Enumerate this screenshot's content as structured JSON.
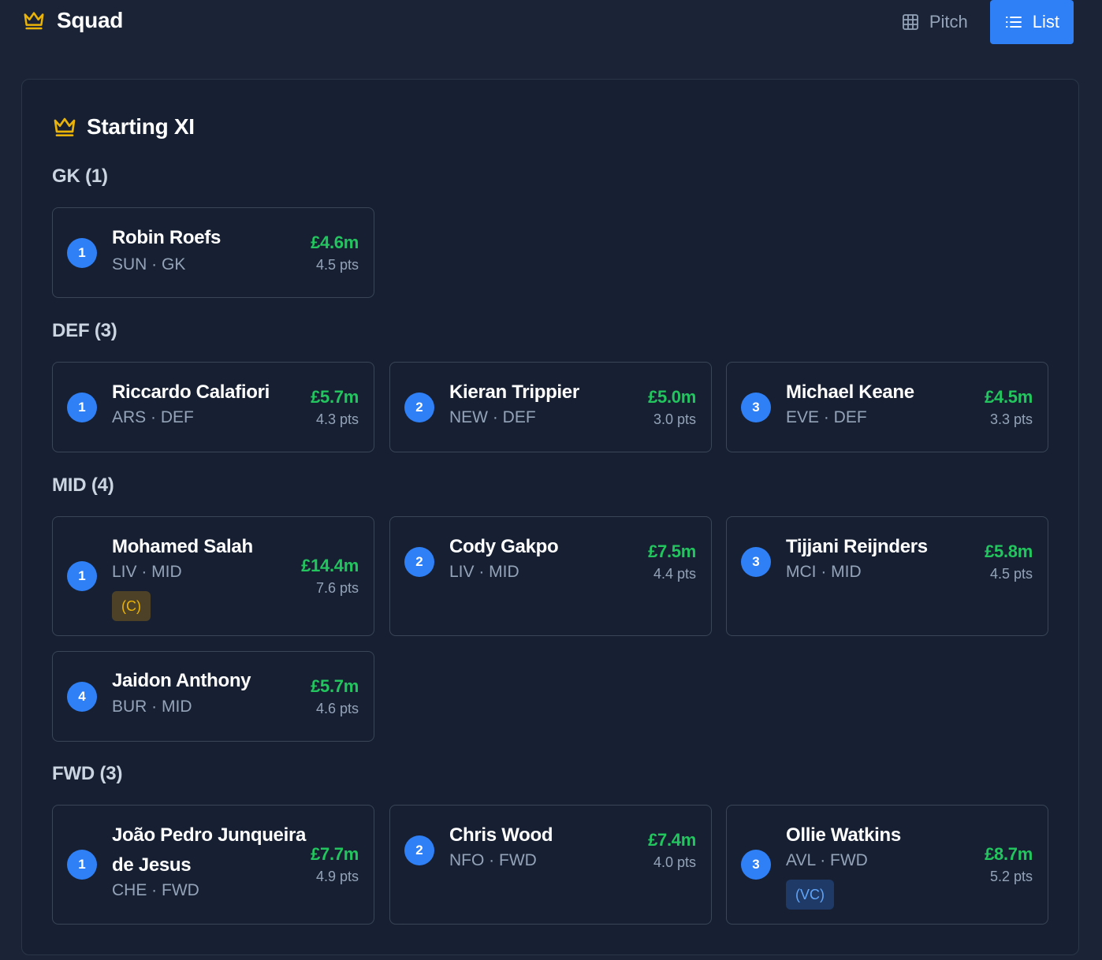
{
  "header": {
    "title": "Squad",
    "views": [
      {
        "label": "Pitch",
        "active": false
      },
      {
        "label": "List",
        "active": true
      }
    ]
  },
  "panel": {
    "title": "Starting XI"
  },
  "groups": [
    {
      "label": "GK (1)",
      "players": [
        {
          "num": "1",
          "name": "Robin Roefs",
          "team": "SUN",
          "pos": "GK",
          "meta": "SUN · GK",
          "price": "£4.6m",
          "pts": "4.5 pts"
        }
      ]
    },
    {
      "label": "DEF (3)",
      "players": [
        {
          "num": "1",
          "name": "Riccardo Calafiori",
          "meta": "ARS · DEF",
          "price": "£5.7m",
          "pts": "4.3 pts"
        },
        {
          "num": "2",
          "name": "Kieran Trippier",
          "meta": "NEW · DEF",
          "price": "£5.0m",
          "pts": "3.0 pts"
        },
        {
          "num": "3",
          "name": "Michael Keane",
          "meta": "EVE · DEF",
          "price": "£4.5m",
          "pts": "3.3 pts"
        }
      ]
    },
    {
      "label": "MID (4)",
      "players": [
        {
          "num": "1",
          "name": "Mohamed Salah",
          "meta": "LIV · MID",
          "price": "£14.4m",
          "pts": "7.6 pts",
          "badge": "(C)"
        },
        {
          "num": "2",
          "name": "Cody Gakpo",
          "meta": "LIV · MID",
          "price": "£7.5m",
          "pts": "4.4 pts"
        },
        {
          "num": "3",
          "name": "Tijjani Reijnders",
          "meta": "MCI · MID",
          "price": "£5.8m",
          "pts": "4.5 pts"
        },
        {
          "num": "4",
          "name": "Jaidon Anthony",
          "meta": "BUR · MID",
          "price": "£5.7m",
          "pts": "4.6 pts"
        }
      ]
    },
    {
      "label": "FWD (3)",
      "players": [
        {
          "num": "1",
          "name": "João Pedro Junqueira de Jesus",
          "meta": "CHE · FWD",
          "price": "£7.7m",
          "pts": "4.9 pts"
        },
        {
          "num": "2",
          "name": "Chris Wood",
          "meta": "NFO · FWD",
          "price": "£7.4m",
          "pts": "4.0 pts"
        },
        {
          "num": "3",
          "name": "Ollie Watkins",
          "meta": "AVL · FWD",
          "price": "£8.7m",
          "pts": "5.2 pts",
          "badge": "(VC)"
        }
      ]
    }
  ],
  "icons": {
    "brand": "crown-icon",
    "pitch": "grid-icon",
    "list": "list-icon"
  },
  "colors": {
    "accent": "#2f80f7",
    "price": "#22c55e",
    "crown": "#eab308",
    "background": "#1b2437",
    "panel": "#172033"
  }
}
